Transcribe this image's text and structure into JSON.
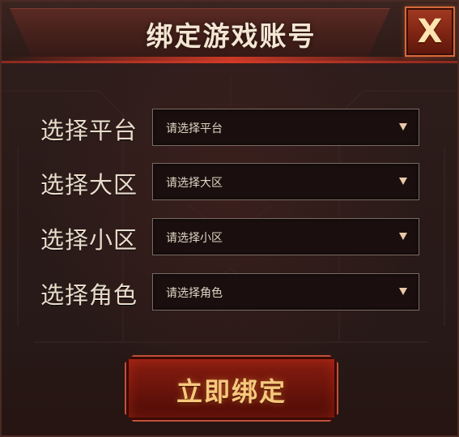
{
  "dialog": {
    "title": "绑定游戏账号",
    "close_label": "X"
  },
  "form": {
    "rows": [
      {
        "label": "选择平台",
        "placeholder": "请选择平台"
      },
      {
        "label": "选择大区",
        "placeholder": "请选择大区"
      },
      {
        "label": "选择小区",
        "placeholder": "请选择小区"
      },
      {
        "label": "选择角色",
        "placeholder": "请选择角色"
      }
    ]
  },
  "actions": {
    "bind_label": "立即绑定"
  },
  "colors": {
    "accent": "#c0503a",
    "title_text": "#f3e6d4",
    "button_text": "#f6c97e"
  },
  "icons": {
    "close": "close-icon",
    "dropdown": "dropdown-arrow-icon"
  }
}
